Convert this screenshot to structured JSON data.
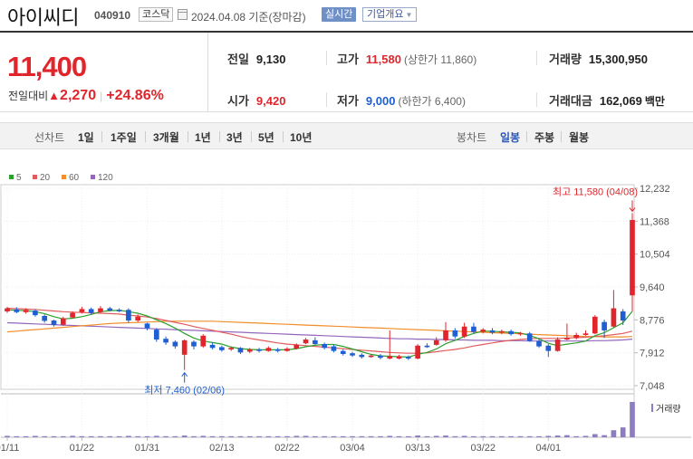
{
  "header": {
    "name": "아이씨디",
    "code": "040910",
    "market": "코스닥",
    "date": "2024.04.08 기준(장마감)",
    "realtime_label": "실시간",
    "company_label": "기업개요"
  },
  "price": {
    "current": "11,400",
    "change_label": "전일대비",
    "change": "2,270",
    "change_rate": "+24.86%"
  },
  "summary": {
    "prev_close": {
      "label": "전일",
      "value": "9,130"
    },
    "high": {
      "label": "고가",
      "value": "11,580",
      "limit": "(상한가 11,860)"
    },
    "volume": {
      "label": "거래량",
      "value": "15,300,950"
    },
    "open": {
      "label": "시가",
      "value": "9,420"
    },
    "low": {
      "label": "저가",
      "value": "9,000",
      "limit": "(하한가 6,400)"
    },
    "amount": {
      "label": "거래대금",
      "value": "162,069",
      "unit": "백만"
    }
  },
  "toolbar": {
    "line_chart_label": "선차트",
    "periods": [
      "1일",
      "1주일",
      "3개월",
      "1년",
      "3년",
      "5년",
      "10년"
    ],
    "candle_label": "봉차트",
    "candles": [
      "일봉",
      "주봉",
      "월봉"
    ],
    "selected_candle": "일봉"
  },
  "legend": [
    {
      "label": "5",
      "color": "#2ca02c"
    },
    {
      "label": "20",
      "color": "#e05b5b"
    },
    {
      "label": "60",
      "color": "#f28e2b"
    },
    {
      "label": "120",
      "color": "#9467bd"
    }
  ],
  "chart_data": {
    "type": "candlestick",
    "y_ticks": [
      "12,232",
      "11,368",
      "10,504",
      "9,640",
      "8,776",
      "7,912",
      "7,048"
    ],
    "y_tick_values": [
      12232,
      11368,
      10504,
      9640,
      8776,
      7912,
      7048
    ],
    "ylim": [
      7048,
      12232
    ],
    "x_tick_labels": [
      "01/11",
      "01/22",
      "01/31",
      "02/13",
      "02/22",
      "03/04",
      "03/13",
      "03/22",
      "04/01"
    ],
    "x_tick_index": [
      0,
      8,
      15,
      23,
      30,
      37,
      44,
      51,
      58
    ],
    "high_annotation": "최고 11,580 (04/08)",
    "low_annotation": "최저 7,460 (02/06)",
    "volume_label": "거래량",
    "candles": [
      {
        "o": 9000,
        "c": 9080,
        "h": 9120,
        "l": 8960
      },
      {
        "o": 9050,
        "c:": 0,
        "c": 8980,
        "h": 9110,
        "l": 8950
      },
      {
        "o": 8980,
        "c": 9040,
        "h": 9080,
        "l": 8940
      },
      {
        "o": 9020,
        "c": 8900,
        "h": 9060,
        "l": 8860
      },
      {
        "o": 8880,
        "c": 8750,
        "h": 8920,
        "l": 8700
      },
      {
        "o": 8760,
        "c": 8640,
        "h": 8780,
        "l": 8600
      },
      {
        "o": 8650,
        "c": 8820,
        "h": 8860,
        "l": 8620
      },
      {
        "o": 8840,
        "c": 8960,
        "h": 9000,
        "l": 8820
      },
      {
        "o": 8980,
        "c": 9060,
        "h": 9120,
        "l": 8940
      },
      {
        "o": 9060,
        "c": 8960,
        "h": 9100,
        "l": 8920
      },
      {
        "o": 8980,
        "c": 9080,
        "h": 9140,
        "l": 8960
      },
      {
        "o": 9080,
        "c": 9020,
        "h": 9120,
        "l": 9000
      },
      {
        "o": 9040,
        "c": 9000,
        "h": 9080,
        "l": 8980
      },
      {
        "o": 9040,
        "c": 8760,
        "h": 9080,
        "l": 8700
      },
      {
        "o": 8760,
        "c": 8860,
        "h": 8920,
        "l": 8720
      },
      {
        "o": 8680,
        "c": 8560,
        "h": 8700,
        "l": 8500
      },
      {
        "o": 8520,
        "c": 8260,
        "h": 8560,
        "l": 8200
      },
      {
        "o": 8280,
        "c": 8180,
        "h": 8340,
        "l": 8120
      },
      {
        "o": 8200,
        "c": 8080,
        "h": 8240,
        "l": 8020
      },
      {
        "o": 7860,
        "c": 8240,
        "h": 8260,
        "l": 7460
      },
      {
        "o": 8200,
        "c": 8080,
        "h": 8240,
        "l": 8000
      },
      {
        "o": 8080,
        "c": 8360,
        "h": 8400,
        "l": 8040
      },
      {
        "o": 8120,
        "c": 8040,
        "h": 8180,
        "l": 8000
      },
      {
        "o": 8060,
        "c": 7980,
        "h": 8100,
        "l": 7940
      },
      {
        "o": 8000,
        "c": 8040,
        "h": 8080,
        "l": 7960
      },
      {
        "o": 8040,
        "c": 7920,
        "h": 8060,
        "l": 7880
      },
      {
        "o": 7940,
        "c": 8000,
        "h": 8040,
        "l": 7900
      },
      {
        "o": 8000,
        "c": 7960,
        "h": 8040,
        "l": 7920
      },
      {
        "o": 7960,
        "c": 8040,
        "h": 8080,
        "l": 7940
      },
      {
        "o": 8000,
        "c": 7960,
        "h": 8040,
        "l": 7920
      },
      {
        "o": 7960,
        "c": 8020,
        "h": 8060,
        "l": 7940
      },
      {
        "o": 8020,
        "c": 8120,
        "h": 8160,
        "l": 8000
      },
      {
        "o": 8160,
        "c": 8260,
        "h": 8300,
        "l": 8140
      },
      {
        "o": 8240,
        "c": 8140,
        "h": 8320,
        "l": 8120
      },
      {
        "o": 8140,
        "c": 8040,
        "h": 8180,
        "l": 8000
      },
      {
        "o": 8080,
        "c": 7960,
        "h": 8120,
        "l": 7920
      },
      {
        "o": 7960,
        "c": 7880,
        "h": 8000,
        "l": 7840
      },
      {
        "o": 7900,
        "c": 7840,
        "h": 7940,
        "l": 7800
      },
      {
        "o": 7860,
        "c": 7800,
        "h": 7900,
        "l": 7760
      },
      {
        "o": 7800,
        "c": 7840,
        "h": 7880,
        "l": 7780
      },
      {
        "o": 7840,
        "c": 7780,
        "h": 7880,
        "l": 7740
      },
      {
        "o": 7760,
        "c": 7820,
        "h": 8500,
        "l": 7740
      },
      {
        "o": 7760,
        "c": 7820,
        "h": 7860,
        "l": 7740
      },
      {
        "o": 7800,
        "c": 7760,
        "h": 7840,
        "l": 7720
      },
      {
        "o": 7760,
        "c": 8100,
        "h": 8140,
        "l": 7740
      },
      {
        "o": 8100,
        "c": 8060,
        "h": 8160,
        "l": 8040
      },
      {
        "o": 8120,
        "c": 8240,
        "h": 8320,
        "l": 8100
      },
      {
        "o": 8240,
        "c": 8500,
        "h": 8720,
        "l": 8200
      },
      {
        "o": 8500,
        "c": 8340,
        "h": 8560,
        "l": 8280
      },
      {
        "o": 8340,
        "c": 8600,
        "h": 8700,
        "l": 8300
      },
      {
        "o": 8600,
        "c": 8460,
        "h": 8700,
        "l": 8420
      },
      {
        "o": 8460,
        "c": 8520,
        "h": 8560,
        "l": 8420
      },
      {
        "o": 8500,
        "c": 8440,
        "h": 8560,
        "l": 8400
      },
      {
        "o": 8440,
        "c": 8480,
        "h": 8520,
        "l": 8400
      },
      {
        "o": 8480,
        "c": 8400,
        "h": 8520,
        "l": 8360
      },
      {
        "o": 8400,
        "c": 8420,
        "h": 8460,
        "l": 8360
      },
      {
        "o": 8420,
        "c": 8220,
        "h": 8460,
        "l": 8200
      },
      {
        "o": 8220,
        "c": 8080,
        "h": 8280,
        "l": 8040
      },
      {
        "o": 8100,
        "c": 7960,
        "h": 8140,
        "l": 7800
      },
      {
        "o": 7960,
        "c": 8260,
        "h": 8320,
        "l": 7940
      },
      {
        "o": 8260,
        "c": 8300,
        "h": 8680,
        "l": 8240
      },
      {
        "o": 8300,
        "c": 8380,
        "h": 8440,
        "l": 8260
      },
      {
        "o": 8380,
        "c": 8420,
        "h": 8500,
        "l": 8360
      },
      {
        "o": 8420,
        "c": 8860,
        "h": 8900,
        "l": 8400
      },
      {
        "o": 8720,
        "c": 8500,
        "h": 8780,
        "l": 8300
      },
      {
        "o": 8600,
        "c": 9080,
        "h": 9560,
        "l": 8580
      },
      {
        "o": 9000,
        "c": 8760,
        "h": 9060,
        "l": 8640
      },
      {
        "o": 9420,
        "c": 11400,
        "h": 11580,
        "l": 9000
      }
    ],
    "volume_relative": [
      0.04,
      0.03,
      0.03,
      0.04,
      0.03,
      0.03,
      0.03,
      0.04,
      0.03,
      0.03,
      0.03,
      0.03,
      0.03,
      0.04,
      0.03,
      0.03,
      0.04,
      0.03,
      0.03,
      0.05,
      0.03,
      0.04,
      0.03,
      0.03,
      0.03,
      0.03,
      0.03,
      0.03,
      0.03,
      0.03,
      0.03,
      0.04,
      0.04,
      0.03,
      0.03,
      0.03,
      0.03,
      0.03,
      0.03,
      0.03,
      0.03,
      0.04,
      0.03,
      0.03,
      0.05,
      0.03,
      0.04,
      0.05,
      0.03,
      0.04,
      0.03,
      0.03,
      0.03,
      0.03,
      0.03,
      0.03,
      0.03,
      0.03,
      0.04,
      0.05,
      0.06,
      0.03,
      0.04,
      0.09,
      0.06,
      0.2,
      0.28,
      1.0
    ],
    "ma5": [
      9040,
      9030,
      9020,
      8990,
      8940,
      8860,
      8800,
      8820,
      8860,
      8920,
      8990,
      9020,
      9030,
      8990,
      8950,
      8880,
      8780,
      8680,
      8560,
      8420,
      8300,
      8220,
      8180,
      8140,
      8060,
      8020,
      8000,
      7990,
      7990,
      7990,
      7990,
      8020,
      8070,
      8110,
      8130,
      8130,
      8080,
      8010,
      7940,
      7870,
      7830,
      7820,
      7810,
      7800,
      7870,
      7920,
      8010,
      8150,
      8240,
      8340,
      8420,
      8480,
      8480,
      8460,
      8450,
      8430,
      8370,
      8280,
      8160,
      8100,
      8140,
      8170,
      8220,
      8360,
      8440,
      8570,
      8700,
      9000
    ],
    "ma20": [
      9080,
      9070,
      9060,
      9050,
      9030,
      9010,
      8990,
      8980,
      8970,
      8960,
      8950,
      8940,
      8930,
      8900,
      8880,
      8850,
      8810,
      8760,
      8710,
      8660,
      8600,
      8550,
      8500,
      8450,
      8400,
      8340,
      8290,
      8250,
      8210,
      8170,
      8140,
      8120,
      8100,
      8080,
      8060,
      8040,
      8020,
      8000,
      7980,
      7960,
      7940,
      7920,
      7910,
      7900,
      7900,
      7910,
      7940,
      7970,
      8000,
      8040,
      8090,
      8130,
      8170,
      8210,
      8240,
      8260,
      8280,
      8290,
      8290,
      8290,
      8300,
      8310,
      8320,
      8340,
      8360,
      8390,
      8420,
      8480
    ],
    "ma60": [
      8460,
      8480,
      8500,
      8520,
      8540,
      8560,
      8580,
      8600,
      8620,
      8640,
      8660,
      8680,
      8690,
      8700,
      8710,
      8720,
      8730,
      8740,
      8740,
      8740,
      8740,
      8740,
      8740,
      8730,
      8720,
      8710,
      8700,
      8690,
      8680,
      8670,
      8660,
      8650,
      8640,
      8630,
      8620,
      8610,
      8600,
      8590,
      8580,
      8570,
      8560,
      8550,
      8540,
      8530,
      8520,
      8510,
      8500,
      8490,
      8480,
      8470,
      8460,
      8450,
      8440,
      8430,
      8420,
      8410,
      8400,
      8390,
      8380,
      8370,
      8360,
      8350,
      8340,
      8340,
      8330,
      8330,
      8330,
      8340
    ],
    "ma120": [
      8700,
      8690,
      8680,
      8670,
      8660,
      8650,
      8640,
      8630,
      8620,
      8610,
      8600,
      8590,
      8580,
      8570,
      8560,
      8550,
      8540,
      8530,
      8520,
      8510,
      8500,
      8490,
      8480,
      8470,
      8460,
      8450,
      8440,
      8430,
      8420,
      8410,
      8400,
      8390,
      8380,
      8370,
      8360,
      8350,
      8340,
      8330,
      8320,
      8310,
      8300,
      8290,
      8280,
      8280,
      8270,
      8270,
      8260,
      8260,
      8250,
      8250,
      8240,
      8240,
      8240,
      8230,
      8230,
      8230,
      8220,
      8220,
      8220,
      8220,
      8220,
      8220,
      8220,
      8230,
      8230,
      8240,
      8250,
      8270
    ]
  }
}
